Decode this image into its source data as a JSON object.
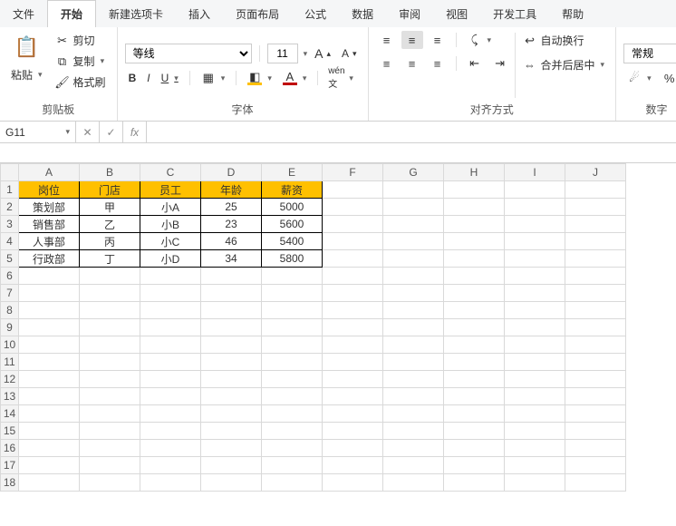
{
  "tabs": {
    "file": "文件",
    "home": "开始",
    "newtab": "新建选项卡",
    "insert": "插入",
    "layout": "页面布局",
    "formula": "公式",
    "data": "数据",
    "review": "审阅",
    "view": "视图",
    "dev": "开发工具",
    "help": "帮助"
  },
  "ribbon": {
    "clipboard": {
      "label": "剪贴板",
      "paste": "粘贴",
      "cut": "剪切",
      "copy": "复制",
      "format": "格式刷"
    },
    "font": {
      "label": "字体",
      "name": "等线",
      "size": "11",
      "bold": "B",
      "italic": "I",
      "underline": "U"
    },
    "align": {
      "label": "对齐方式",
      "wrap": "自动换行",
      "merge": "合并后居中"
    },
    "number": {
      "label": "数字",
      "format": "常规"
    }
  },
  "fbar": {
    "cell": "G11",
    "fx": "fx",
    "value": ""
  },
  "cols": [
    "A",
    "B",
    "C",
    "D",
    "E",
    "F",
    "G",
    "H",
    "I",
    "J"
  ],
  "rowcount": 18,
  "headers": [
    "岗位",
    "门店",
    "员工",
    "年龄",
    "薪资"
  ],
  "rows": [
    [
      "策划部",
      "甲",
      "小A",
      "25",
      "5000"
    ],
    [
      "销售部",
      "乙",
      "小B",
      "23",
      "5600"
    ],
    [
      "人事部",
      "丙",
      "小C",
      "46",
      "5400"
    ],
    [
      "行政部",
      "丁",
      "小D",
      "34",
      "5800"
    ]
  ],
  "chart_data": {
    "type": "table",
    "columns": [
      "岗位",
      "门店",
      "员工",
      "年龄",
      "薪资"
    ],
    "data": [
      {
        "岗位": "策划部",
        "门店": "甲",
        "员工": "小A",
        "年龄": 25,
        "薪资": 5000
      },
      {
        "岗位": "销售部",
        "门店": "乙",
        "员工": "小B",
        "年龄": 23,
        "薪资": 5600
      },
      {
        "岗位": "人事部",
        "门店": "丙",
        "员工": "小C",
        "年龄": 46,
        "薪资": 5400
      },
      {
        "岗位": "行政部",
        "门店": "丁",
        "员工": "小D",
        "年龄": 34,
        "薪资": 5800
      }
    ]
  }
}
